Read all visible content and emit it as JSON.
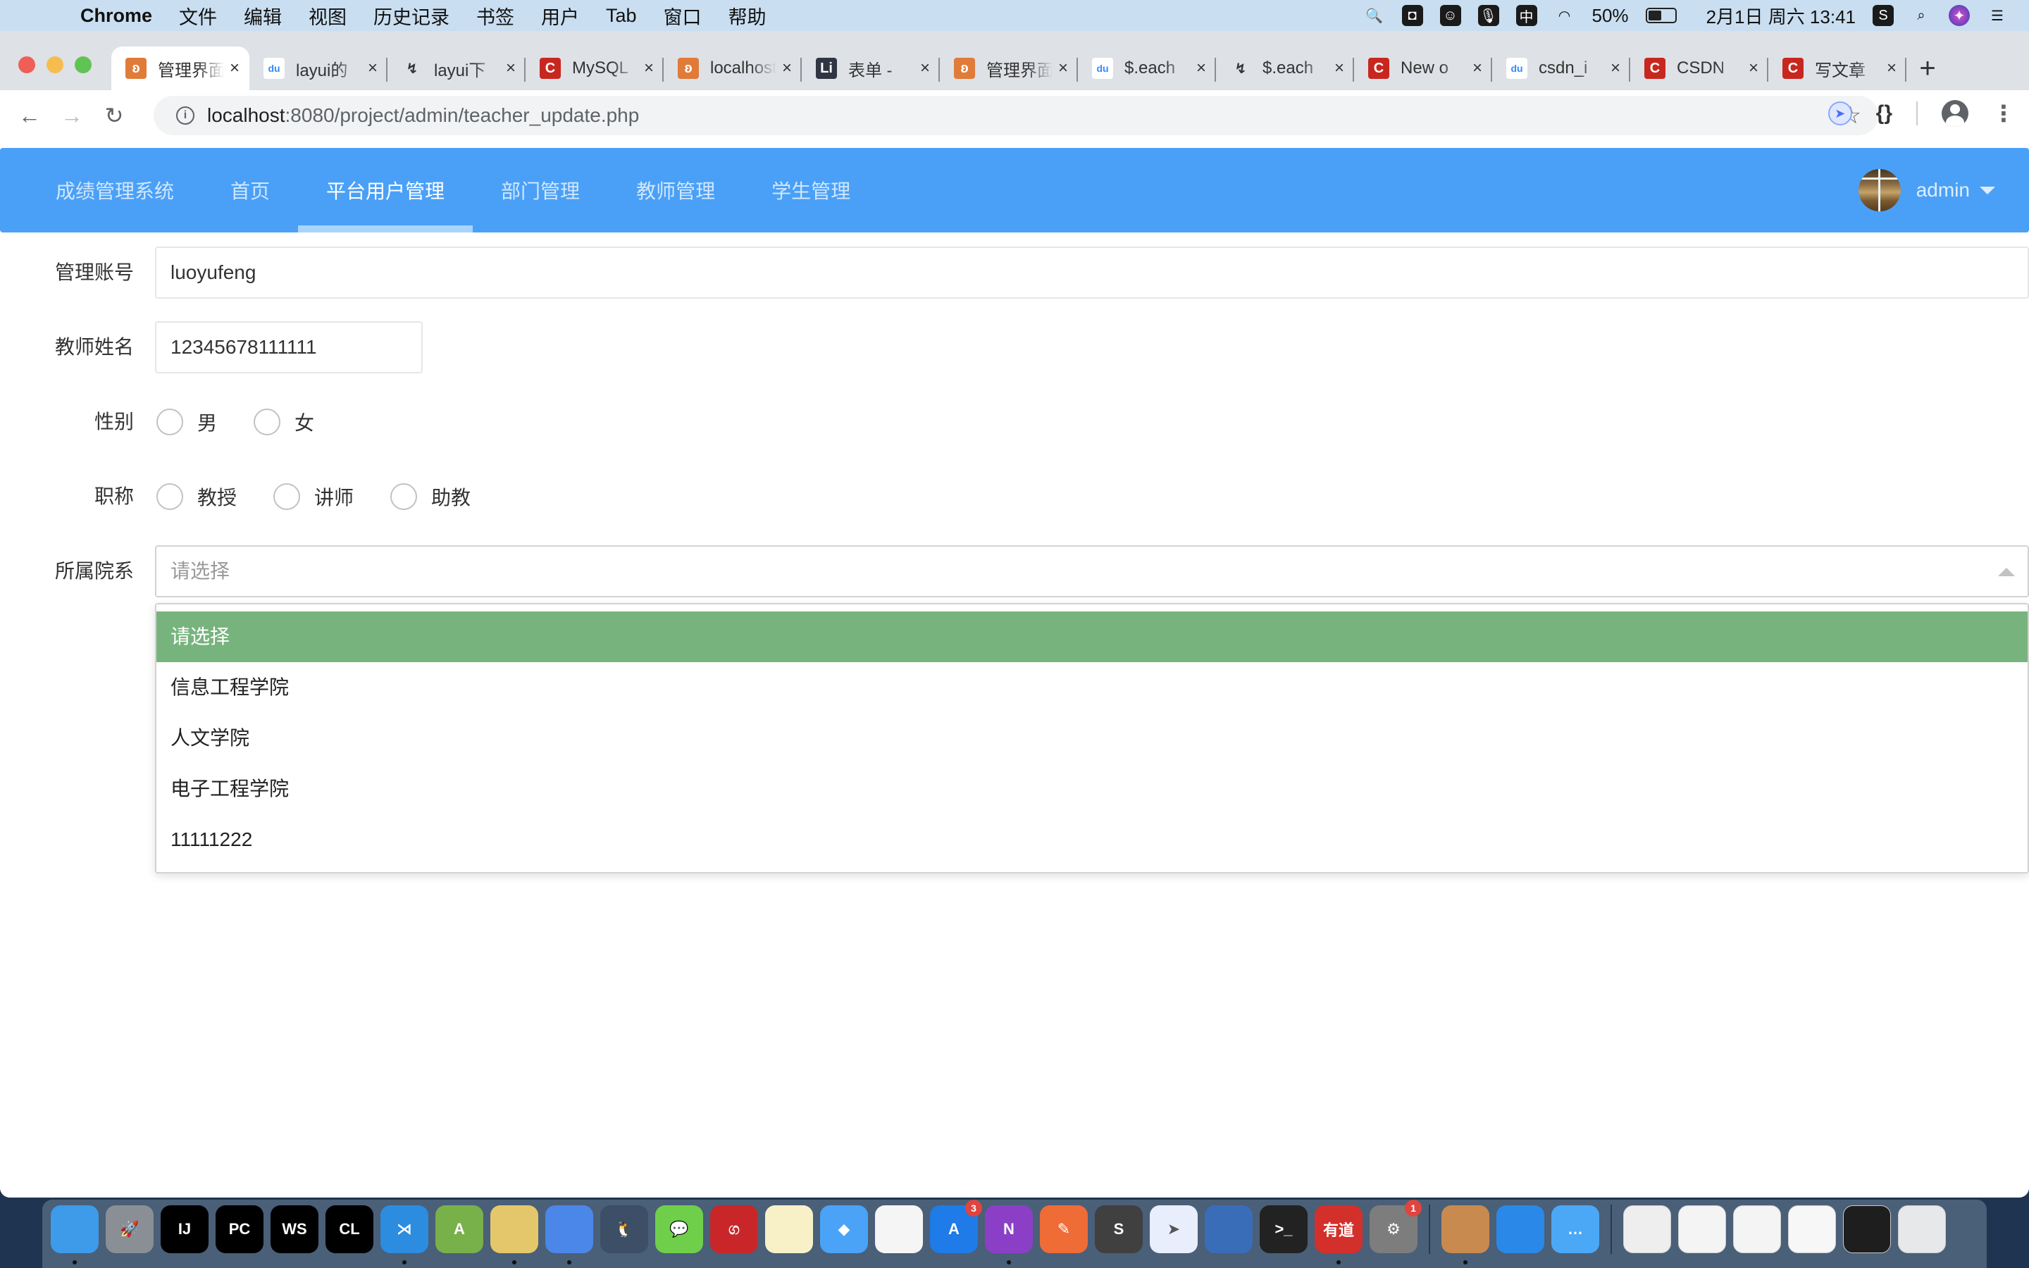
{
  "menubar": {
    "app_name": "Chrome",
    "menus": [
      "文件",
      "编辑",
      "视图",
      "历史记录",
      "书签",
      "用户",
      "Tab",
      "窗口",
      "帮助"
    ],
    "battery_percent": "50%",
    "battery_level": 0.5,
    "datetime": "2月1日 周六 13:41",
    "ime_label": "中"
  },
  "browser": {
    "tabs": [
      {
        "title": "管理界面",
        "favicon": "xampp-icon",
        "favicon_color": "#e07b39",
        "active": true
      },
      {
        "title": "layui的",
        "favicon": "baidu-icon",
        "favicon_color": "#3388ff",
        "active": false
      },
      {
        "title": "layui下",
        "favicon": "layui-icon",
        "favicon_color": "#333333",
        "active": false
      },
      {
        "title": "MySQL",
        "favicon": "csdn-icon",
        "favicon_color": "#c7271f",
        "active": false
      },
      {
        "title": "localhost",
        "favicon": "xampp-icon",
        "favicon_color": "#e07b39",
        "active": false
      },
      {
        "title": "表单 - ",
        "favicon": "layui-doc-icon",
        "favicon_color": "#2f3542",
        "active": false
      },
      {
        "title": "管理界面",
        "favicon": "xampp-icon",
        "favicon_color": "#e07b39",
        "active": false
      },
      {
        "title": "$.each",
        "favicon": "baidu-icon",
        "favicon_color": "#3388ff",
        "active": false
      },
      {
        "title": "$.each",
        "favicon": "layui-icon",
        "favicon_color": "#333333",
        "active": false
      },
      {
        "title": "New o",
        "favicon": "csdn-icon",
        "favicon_color": "#c7271f",
        "active": false
      },
      {
        "title": "csdn_i",
        "favicon": "baidu-icon",
        "favicon_color": "#3388ff",
        "active": false
      },
      {
        "title": "CSDN",
        "favicon": "csdn-icon",
        "favicon_color": "#c7271f",
        "active": false
      },
      {
        "title": "写文章",
        "favicon": "csdn-icon",
        "favicon_color": "#c7271f",
        "active": false
      }
    ],
    "url_host": "localhost",
    "url_path": ":8080/project/admin/teacher_update.php"
  },
  "app": {
    "nav": {
      "brand": "成绩管理系统",
      "items": [
        {
          "label": "首页",
          "active": false
        },
        {
          "label": "平台用户管理",
          "active": true
        },
        {
          "label": "部门管理",
          "active": false
        },
        {
          "label": "教师管理",
          "active": false
        },
        {
          "label": "学生管理",
          "active": false
        }
      ],
      "user": "admin",
      "accent": "#4aa0f7"
    },
    "form": {
      "account": {
        "label": "管理账号",
        "value": "luoyufeng"
      },
      "teacher_name": {
        "label": "教师姓名",
        "value": "12345678111111"
      },
      "gender": {
        "label": "性别",
        "options": [
          "男",
          "女"
        ],
        "selected": null
      },
      "title": {
        "label": "职称",
        "options": [
          "教授",
          "讲师",
          "助教"
        ],
        "selected": null
      },
      "department": {
        "label": "所属院系",
        "placeholder": "请选择",
        "open": true,
        "options": [
          "请选择",
          "信息工程学院",
          "人文学院",
          "电子工程学院",
          "11111222"
        ],
        "highlighted_index": 0,
        "highlight_color": "#77b47d"
      }
    }
  },
  "dock": {
    "apps": [
      {
        "name": "finder",
        "label": "",
        "color": "#3d9be9",
        "running": true
      },
      {
        "name": "launchpad",
        "label": "🚀",
        "color": "#8a8f96",
        "running": false
      },
      {
        "name": "intellij",
        "label": "IJ",
        "color": "#000000",
        "running": false
      },
      {
        "name": "pycharm",
        "label": "PC",
        "color": "#000000",
        "running": false
      },
      {
        "name": "webstorm",
        "label": "WS",
        "color": "#000000",
        "running": false
      },
      {
        "name": "clion",
        "label": "CL",
        "color": "#000000",
        "running": false
      },
      {
        "name": "vscode",
        "label": "⋊",
        "color": "#2c8ce0",
        "running": true
      },
      {
        "name": "android-studio",
        "label": "A",
        "color": "#78b04a",
        "running": false
      },
      {
        "name": "sequel-pro",
        "label": "",
        "color": "#e5c76b",
        "running": true
      },
      {
        "name": "chrome",
        "label": "",
        "color": "#4a87e8",
        "running": true
      },
      {
        "name": "qq",
        "label": "🐧",
        "color": "#3c4f66",
        "running": false
      },
      {
        "name": "wechat",
        "label": "💬",
        "color": "#6fcf4a",
        "running": false
      },
      {
        "name": "netease-music",
        "label": "ග",
        "color": "#c9262a",
        "running": false
      },
      {
        "name": "notes",
        "label": "",
        "color": "#f8f1c8",
        "running": false
      },
      {
        "name": "pencil",
        "label": "◆",
        "color": "#4aa3f7",
        "running": false
      },
      {
        "name": "reminders",
        "label": "",
        "color": "#f5f5f5",
        "running": false
      },
      {
        "name": "app-store",
        "label": "A",
        "color": "#1e7be8",
        "running": false,
        "badge": "3"
      },
      {
        "name": "onenote",
        "label": "N",
        "color": "#8b3fc7",
        "running": true
      },
      {
        "name": "postman",
        "label": "✎",
        "color": "#ef6c36",
        "running": false
      },
      {
        "name": "sublime-text",
        "label": "S",
        "color": "#404040",
        "running": false
      },
      {
        "name": "feishu",
        "label": "➤",
        "color": "#e9eefc",
        "running": false
      },
      {
        "name": "parallels",
        "label": "",
        "color": "#3a6db8",
        "running": false
      },
      {
        "name": "terminal",
        "label": ">_",
        "color": "#222222",
        "running": false
      },
      {
        "name": "youdao",
        "label": "有道",
        "color": "#d3302b",
        "running": true
      },
      {
        "name": "system-preferences",
        "label": "⚙",
        "color": "#7d7d7d",
        "running": false,
        "badge": "1"
      }
    ],
    "apps2": [
      {
        "name": "xampp",
        "label": "",
        "color": "#c98a4f",
        "running": true
      },
      {
        "name": "safari",
        "label": "",
        "color": "#2a88e8",
        "running": false
      },
      {
        "name": "messages",
        "label": "…",
        "color": "#4aa8f7",
        "running": false
      }
    ],
    "recent": [
      {
        "name": "recent-doc-1",
        "color": "#eeeeee"
      },
      {
        "name": "recent-finder-window",
        "color": "#f4f4f4"
      },
      {
        "name": "recent-sequel-window",
        "color": "#f4f4f4"
      },
      {
        "name": "recent-xampp-window",
        "color": "#f7f7f7"
      },
      {
        "name": "recent-vscode-window",
        "color": "#1e1e1e"
      },
      {
        "name": "trash",
        "color": "#e6e8ea"
      }
    ]
  }
}
